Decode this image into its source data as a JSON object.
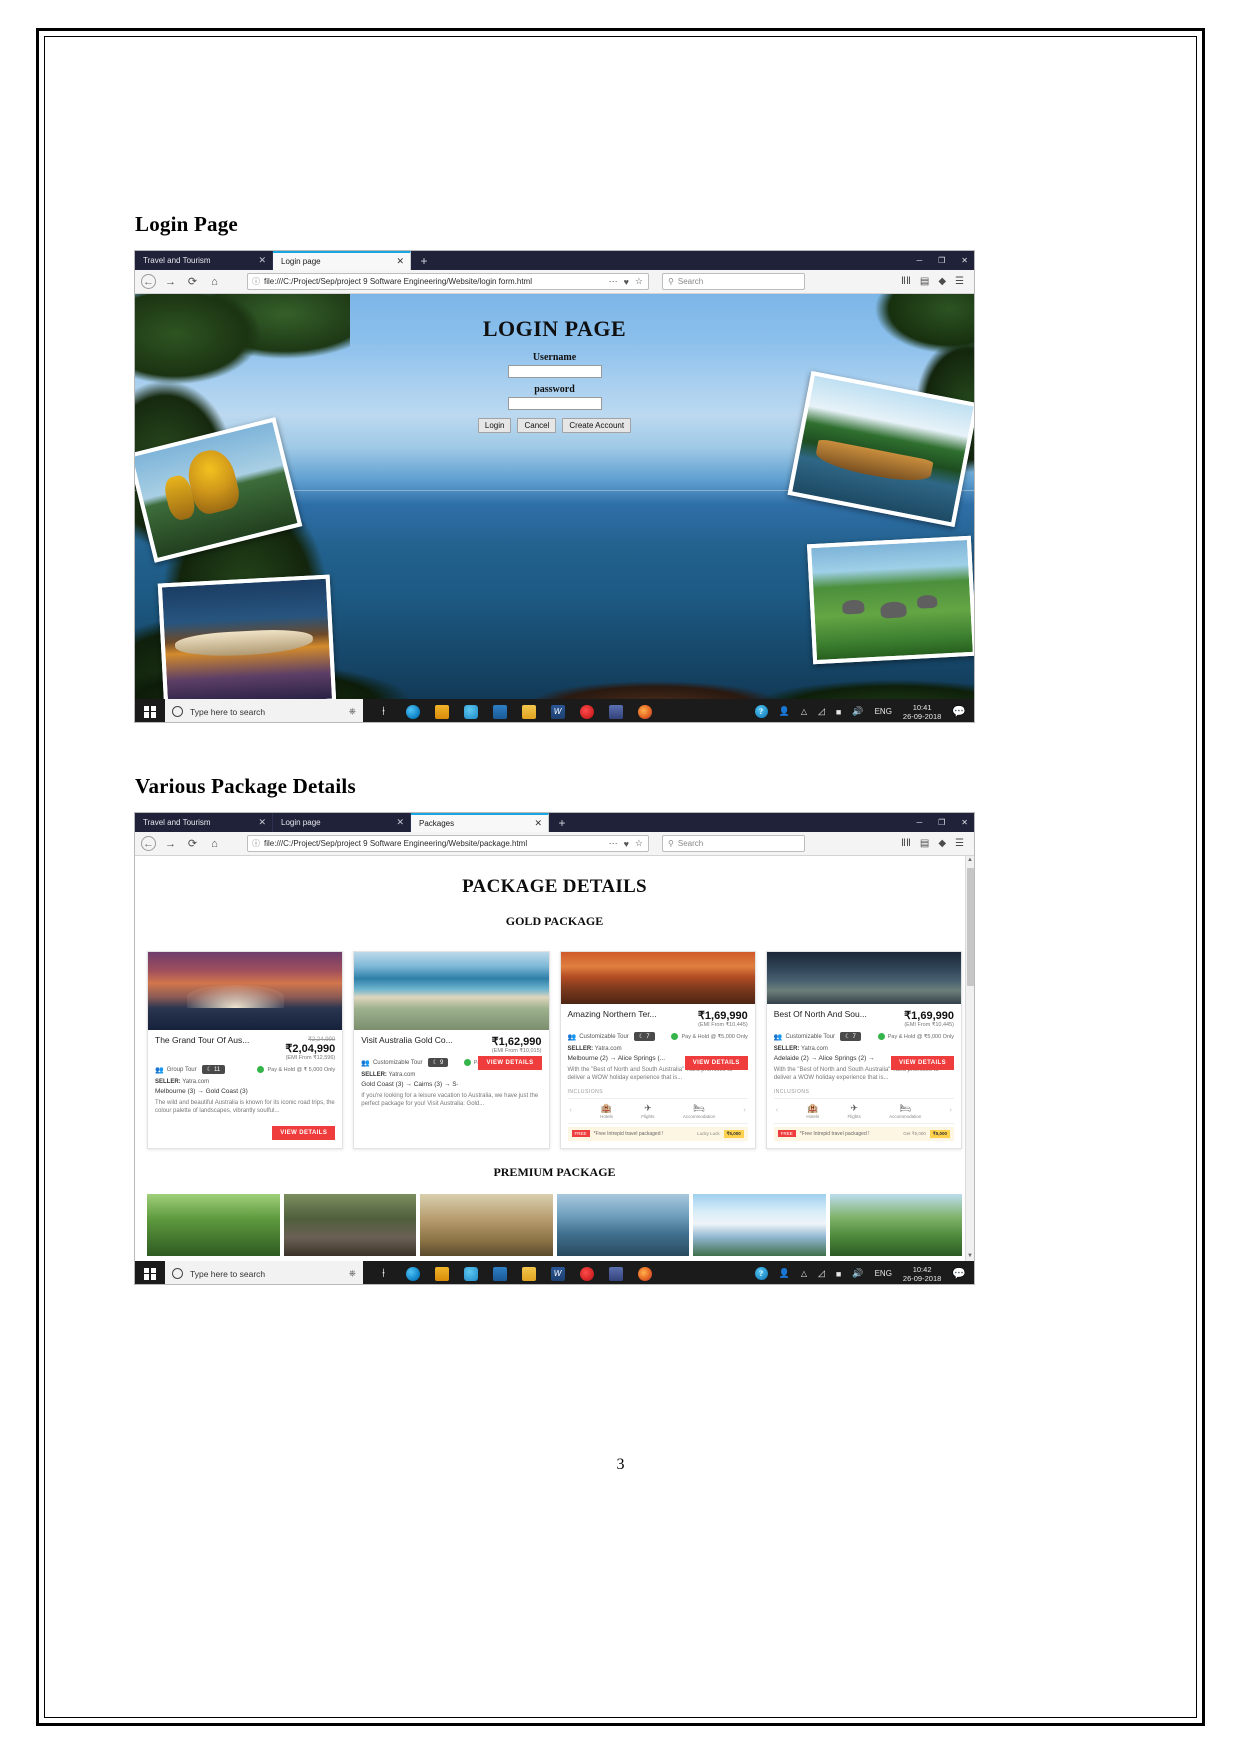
{
  "document": {
    "page_number": "3",
    "sections": [
      {
        "heading": "Login Page"
      },
      {
        "heading": "Various Package Details"
      }
    ]
  },
  "login_screenshot": {
    "tabs": [
      {
        "title": "Travel and Tourism",
        "close": "✕",
        "active": false
      },
      {
        "title": "Login page",
        "close": "✕",
        "active": true
      }
    ],
    "new_tab": "+",
    "window_controls": {
      "minimize": "─",
      "maximize": "❐",
      "close": "✕"
    },
    "nav": {
      "back": "←",
      "forward": "→",
      "reload": "⟳",
      "home": "⌂",
      "info_icon": "ⓘ",
      "url": "file:///C:/Project/Sep/project 9 Software Engineering/Website/login form.html",
      "page_actions": "⋯",
      "reader_shield": "♥",
      "bookmark_star": "☆",
      "search_icon": "⚲",
      "search_placeholder": "Search",
      "library_icon": "ⅡⅡ",
      "sidebar_icon": "▤",
      "account_icon": "◆",
      "menu_icon": "☰"
    },
    "page": {
      "heading": "LOGIN PAGE",
      "username_label": "Username",
      "username_value": "",
      "password_label": "password",
      "password_value": "",
      "buttons": {
        "login": "Login",
        "cancel": "Cancel",
        "create_account": "Create Account"
      }
    },
    "taskbar": {
      "search_placeholder": "Type here to search",
      "language": "ENG",
      "time": "10:41",
      "date": "26-09-2018"
    }
  },
  "package_screenshot": {
    "tabs": [
      {
        "title": "Travel and Tourism",
        "close": "✕",
        "active": false
      },
      {
        "title": "Login page",
        "close": "✕",
        "active": false
      },
      {
        "title": "Packages",
        "close": "✕",
        "active": true
      }
    ],
    "new_tab": "+",
    "window_controls": {
      "minimize": "─",
      "maximize": "❐",
      "close": "✕"
    },
    "nav": {
      "back": "←",
      "forward": "→",
      "reload": "⟳",
      "home": "⌂",
      "info_icon": "ⓘ",
      "url": "file:///C:/Project/Sep/project 9 Software Engineering/Website/package.html",
      "page_actions": "⋯",
      "reader_shield": "♥",
      "bookmark_star": "☆",
      "search_icon": "⚲",
      "search_placeholder": "Search",
      "library_icon": "ⅡⅡ",
      "sidebar_icon": "▤",
      "account_icon": "◆",
      "menu_icon": "☰"
    },
    "page": {
      "title": "PACKAGE DETAILS",
      "gold_heading": "GOLD PACKAGE",
      "premium_heading": "PREMIUM PACKAGE",
      "scroll_up": "▲",
      "scroll_down": "▼",
      "cards": [
        {
          "name": "The Grand Tour Of Aus...",
          "price_old": "₹2,24,990",
          "price_new": "₹2,04,990",
          "emi": "(EMI From ₹12,596)",
          "tour_type": "Group Tour",
          "nights": "11",
          "hold": "Pay & Hold @ ₹ 5,000 Only",
          "seller_label": "SELLER:",
          "seller": "Yatra.com",
          "route": "Melbourne (3)  →  Gold Coast (3)",
          "description": "The wild and beautiful Australia is known for its iconic road trips, the colour palette of landscapes, vibrantly soulful...",
          "view_details": "VIEW DETAILS"
        },
        {
          "name": "Visit Australia Gold Co...",
          "price_old": "",
          "price_new": "₹1,62,990",
          "emi": "(EMI From ₹10,015)",
          "tour_type": "Customizable Tour",
          "nights": "9",
          "hold": "Pay & Hold @ ₹ 5,000 Only",
          "seller_label": "SELLER:",
          "seller": "Yatra.com",
          "route": "Gold Coast (3)  →  Cairns (3)  →  S·",
          "description": "If you're looking for a leisure vacation to Australia, we have just the perfect package for you! Visit Australia: Gold...",
          "view_details": "VIEW DETAILS"
        },
        {
          "name": "Amazing Northern Ter...",
          "price_old": "",
          "price_new": "₹1,69,990",
          "emi": "(EMI From ₹10,445)",
          "tour_type": "Customizable Tour",
          "nights": "7",
          "hold": "Pay & Hold @ ₹5,000 Only",
          "seller_label": "SELLER:",
          "seller": "Yatra.com",
          "route": "Melbourne (2)  →  Alice Springs (...",
          "description": "With the \"Best of North and South Australia\" Yatra promises to deliver a WOW holiday experience that is...",
          "view_details": "VIEW DETAILS",
          "inclusions_label": "INCLUSIONS",
          "inclusions": [
            {
              "icon": "🏨",
              "label": "Hotels"
            },
            {
              "icon": "✈",
              "label": "Flights"
            },
            {
              "icon": "🛏",
              "label": "Accommodation"
            }
          ],
          "promo_tag": "FREE",
          "promo_text": "*Free Intrepid travel packaged !",
          "promo_code": "Lucky Luck",
          "promo_amount": "₹5,000"
        },
        {
          "name": "Best Of North And Sou...",
          "price_old": "",
          "price_new": "₹1,69,990",
          "emi": "(EMI From ₹10,445)",
          "tour_type": "Customizable Tour",
          "nights": "7",
          "hold": "Pay & Hold @ ₹5,000 Only",
          "seller_label": "SELLER:",
          "seller": "Yatra.com",
          "route": "Adelaide (2)  →  Alice Springs (2)  →",
          "description": "With the \"Best of North and South Australia\" Yatra promises to deliver a WOW holiday experience that is...",
          "view_details": "VIEW DETAILS",
          "inclusions_label": "INCLUSIONS",
          "inclusions": [
            {
              "icon": "🏨",
              "label": "Hotels"
            },
            {
              "icon": "✈",
              "label": "Flights"
            },
            {
              "icon": "🛏",
              "label": "Accommodation"
            }
          ],
          "promo_tag": "FREE",
          "promo_text": "*Free Intrepid travel packaged !",
          "promo_code": "Get ₹5,000",
          "promo_amount": "₹5,000"
        }
      ]
    },
    "taskbar": {
      "search_placeholder": "Type here to search",
      "language": "ENG",
      "time": "10:42",
      "date": "26-09-2018"
    }
  },
  "colors": {
    "tab_bar": "#1f2238",
    "accent_blue": "#17a6e0",
    "cta_red": "#ef3c3c",
    "taskbar": "#1b1b1b"
  }
}
